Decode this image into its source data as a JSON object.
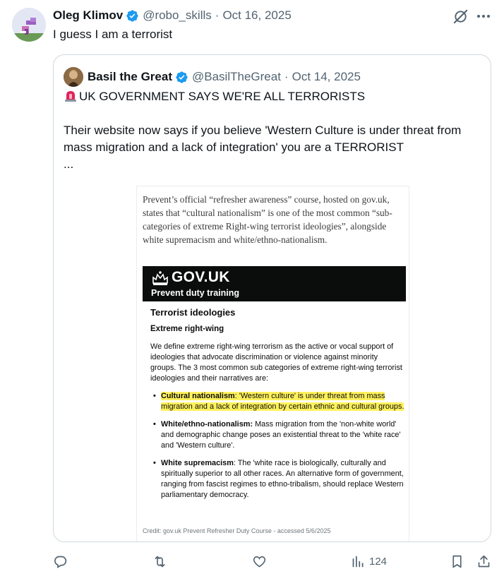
{
  "tweet": {
    "author_name": "Oleg Klimov",
    "handle": "@robo_skills",
    "separator": "·",
    "date": "Oct 16, 2025",
    "text": "I guess I am a terrorist"
  },
  "quoted": {
    "author_name": "Basil the Great",
    "handle": "@BasilTheGreat",
    "separator": "·",
    "date": "Oct 14, 2025",
    "headline": "UK GOVERNMENT SAYS WE'RE ALL TERRORISTS",
    "body": "Their website now says if you believe 'Western Culture is under threat from mass migration and a lack of integration' you are a TERRORIST",
    "ellipsis": "..."
  },
  "article": {
    "intro": "Prevent’s official “refresher awareness” course, hosted on gov.uk, states that “cultural nationalism” is one of the most common “sub-categories of extreme Right-wing terrorist ideologies”, alongside white supremacism and white/ethno-nationalism.",
    "gov_title": "GOV.UK",
    "gov_subtitle": "Prevent duty training",
    "heading": "Terrorist ideologies",
    "subheading": "Extreme right-wing",
    "paragraph": "We define extreme right-wing terrorism as the active or vocal support of ideologies that advocate discrimination or violence against minority groups. The 3 most common sub categories of extreme right-wing terrorist ideologies and their narratives are:",
    "items": [
      {
        "term": "Cultural nationalism",
        "text": ": 'Western culture' is under threat from mass migration and a lack of integration by certain ethnic and cultural groups.",
        "highlighted": true
      },
      {
        "term": "White/ethno-nationalism:",
        "text": " Mass migration from the 'non-white world' and demographic change poses an existential threat to the 'white race' and 'Western culture'.",
        "highlighted": false
      },
      {
        "term": "White supremacism",
        "text": ": The 'white race is biologically, culturally and spiritually superior to all other races. An alternative form of government, ranging from fascist regimes to ethno-tribalism, should replace Western parliamentary democracy.",
        "highlighted": false
      }
    ],
    "credit": "Credit: gov.uk Prevent Refresher Duty Course - accessed 5/6/2025"
  },
  "actions": {
    "views_count": "124"
  },
  "icons": {
    "verified": "verified-badge-icon",
    "grok": "grok-icon",
    "more": "more-icon",
    "siren": "siren-icon",
    "reply": "reply-icon",
    "retweet": "retweet-icon",
    "like": "like-icon",
    "views": "views-icon",
    "bookmark": "bookmark-icon",
    "share": "share-icon"
  },
  "colors": {
    "verified": "#1d9bf0",
    "muted": "#536471",
    "highlight": "#fff15c",
    "gov_bar": "#0b0c0c"
  }
}
